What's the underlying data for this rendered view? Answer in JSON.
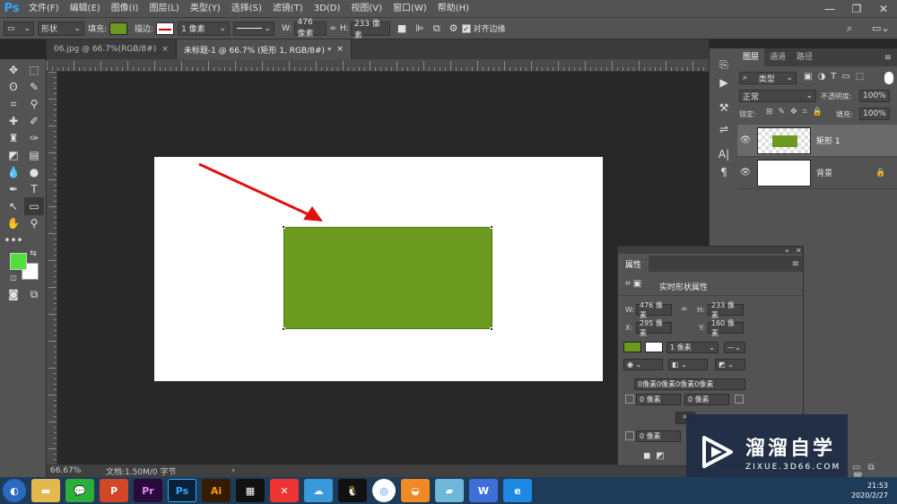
{
  "app": {
    "logo": "Ps"
  },
  "menu": [
    "文件(F)",
    "编辑(E)",
    "图像(I)",
    "图层(L)",
    "类型(Y)",
    "选择(S)",
    "滤镜(T)",
    "3D(D)",
    "视图(V)",
    "窗口(W)",
    "帮助(H)"
  ],
  "options": {
    "mode": "形状",
    "fill_label": "填充:",
    "stroke_label": "描边:",
    "stroke_width": "1 像素",
    "w_label": "W:",
    "w_value": "476 像素",
    "h_label": "H:",
    "h_value": "233 像素",
    "align_edges": "对齐边缘",
    "fill_color": "#6b9a1f"
  },
  "tabs": [
    {
      "label": "06.jpg @ 66.7%(RGB/8#)"
    },
    {
      "label": "未标题-1 @ 66.7% (矩形 1, RGB/8#) *"
    }
  ],
  "status": {
    "zoom": "66.67%",
    "doc": "文档:1.50M/0 字节"
  },
  "layers_panel": {
    "tabs": [
      "图层",
      "通道",
      "路径"
    ],
    "filter": "类型",
    "blend": "正常",
    "opacity_label": "不透明度:",
    "opacity": "100%",
    "lock_label": "锁定:",
    "fill_label": "填充:",
    "fill": "100%",
    "layers": [
      {
        "name": "矩形 1"
      },
      {
        "name": "背景"
      }
    ]
  },
  "properties": {
    "title": "属性",
    "subtitle": "实时形状属性",
    "w": "476 像素",
    "h": "233 像素",
    "x": "295 像素",
    "y": "160 像素",
    "stroke": "1 像素",
    "corners": "0像素0像素0像素0像素",
    "c1": "0 像素",
    "c2": "0 像素",
    "c3": "0 像素"
  },
  "watermark": {
    "title": "溜溜自学",
    "url": "ZIXUE.3D66.COM"
  },
  "clock": {
    "time": "21:53",
    "date": "2020/2/27"
  }
}
